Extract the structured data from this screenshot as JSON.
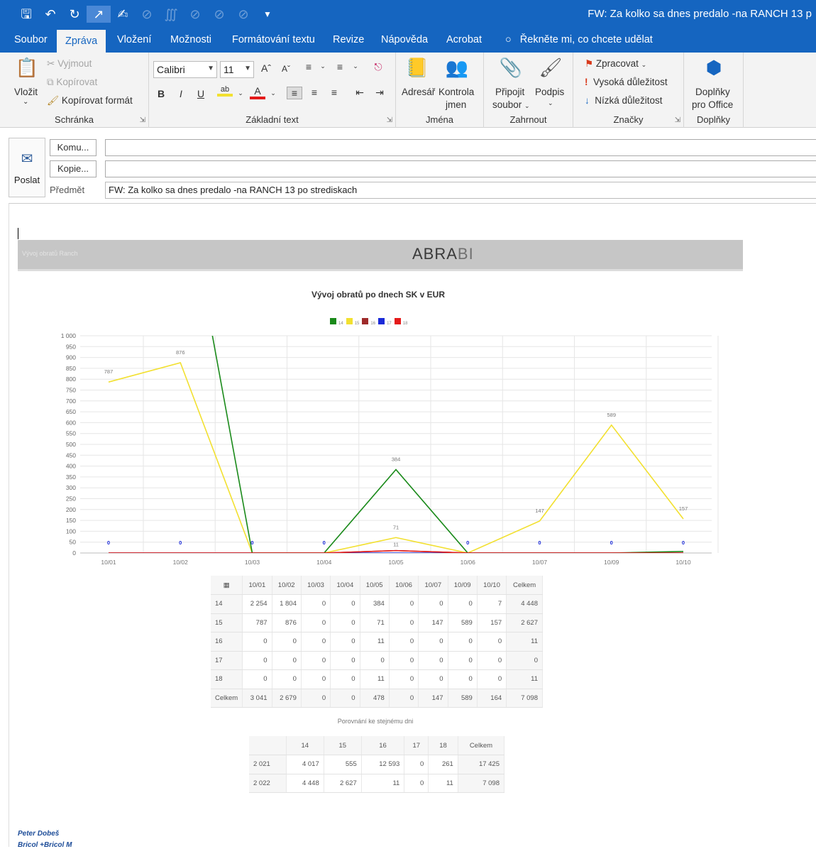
{
  "window": {
    "title": "FW: Za kolko sa dnes predalo -na  RANCH 13  p"
  },
  "quick_access": [
    "save-icon",
    "undo-icon",
    "redo-icon",
    "arrow-icon",
    "touch-icon",
    "brush-icon",
    "formula-icon",
    "brush2-icon",
    "brush3-icon",
    "brush4-icon",
    "customize-icon"
  ],
  "tabs": [
    "Soubor",
    "Zpráva",
    "Vložení",
    "Možnosti",
    "Formátování textu",
    "Revize",
    "Nápověda",
    "Acrobat"
  ],
  "tell_me": "Řekněte mi, co chcete udělat",
  "ribbon": {
    "clipboard": {
      "paste": "Vložit",
      "cut": "Vyjmout",
      "copy": "Kopírovat",
      "format_painter": "Kopírovat formát",
      "label": "Schránka"
    },
    "basic_text": {
      "font": "Calibri",
      "size": "11",
      "label": "Základní text"
    },
    "names": {
      "address_book": "Adresář",
      "check_names_1": "Kontrola",
      "check_names_2": "jmen",
      "label": "Jména"
    },
    "include": {
      "attach_1": "Připojit",
      "attach_2": "soubor",
      "signature": "Podpis",
      "label": "Zahrnout"
    },
    "tags": {
      "followup": "Zpracovat",
      "high": "Vysoká důležitost",
      "low": "Nízká důležitost",
      "label": "Značky"
    },
    "addins": {
      "office_1": "Doplňky",
      "office_2": "pro Office",
      "label": "Doplňky"
    }
  },
  "compose": {
    "send": "Poslat",
    "to": "Komu...",
    "cc": "Kopie...",
    "subject_label": "Předmět",
    "subject": "FW: Za kolko sa dnes predalo -na  RANCH 13  po strediskach"
  },
  "report": {
    "small_title": "Vývoj obratů Ranch",
    "brand_main": "ABRA",
    "brand_sub": "BI"
  },
  "chart_data": {
    "type": "line",
    "title": "Vývoj obratů po dnech SK v EUR",
    "categories": [
      "10/01",
      "10/02",
      "10/03",
      "10/04",
      "10/05",
      "10/06",
      "10/07",
      "10/09",
      "10/10"
    ],
    "ylim": [
      0,
      1000
    ],
    "yticks": [
      "0",
      "50",
      "100",
      "150",
      "200",
      "250",
      "300",
      "350",
      "400",
      "450",
      "500",
      "550",
      "600",
      "650",
      "700",
      "750",
      "800",
      "850",
      "900",
      "950",
      "1 000"
    ],
    "series": [
      {
        "name": "14",
        "color": "#1a8a1a",
        "values": [
          2254,
          1804,
          0,
          0,
          384,
          0,
          0,
          0,
          7
        ]
      },
      {
        "name": "15",
        "color": "#f2e030",
        "values": [
          787,
          876,
          0,
          0,
          71,
          0,
          147,
          589,
          157
        ]
      },
      {
        "name": "16",
        "color": "#9e2a2a",
        "values": [
          0,
          0,
          0,
          0,
          11,
          0,
          0,
          0,
          0
        ]
      },
      {
        "name": "17",
        "color": "#1a2ad8",
        "values": [
          0,
          0,
          0,
          0,
          0,
          0,
          0,
          0,
          0
        ]
      },
      {
        "name": "18",
        "color": "#e41a1a",
        "values": [
          0,
          0,
          0,
          0,
          11,
          0,
          0,
          0,
          0
        ]
      }
    ],
    "point_labels": {
      "14": [
        "",
        "",
        "",
        "",
        "384",
        "",
        "",
        "",
        ""
      ],
      "15": [
        "787",
        "876",
        "",
        "",
        "71",
        "",
        "147",
        "589",
        "157"
      ],
      "16": [
        "",
        "",
        "",
        "",
        "11",
        "",
        "",
        "",
        ""
      ],
      "marker_zero": "0"
    }
  },
  "table1": {
    "corner": "",
    "headers": [
      "10/01",
      "10/02",
      "10/03",
      "10/04",
      "10/05",
      "10/06",
      "10/07",
      "10/09",
      "10/10",
      "Celkem"
    ],
    "rows": [
      {
        "label": "14",
        "cells": [
          "2 254",
          "1 804",
          "0",
          "0",
          "384",
          "0",
          "0",
          "0",
          "7",
          "4 448"
        ]
      },
      {
        "label": "15",
        "cells": [
          "787",
          "876",
          "0",
          "0",
          "71",
          "0",
          "147",
          "589",
          "157",
          "2 627"
        ]
      },
      {
        "label": "16",
        "cells": [
          "0",
          "0",
          "0",
          "0",
          "11",
          "0",
          "0",
          "0",
          "0",
          "11"
        ]
      },
      {
        "label": "17",
        "cells": [
          "0",
          "0",
          "0",
          "0",
          "0",
          "0",
          "0",
          "0",
          "0",
          "0"
        ]
      },
      {
        "label": "18",
        "cells": [
          "0",
          "0",
          "0",
          "0",
          "11",
          "0",
          "0",
          "0",
          "0",
          "11"
        ]
      },
      {
        "label": "Celkem",
        "cells": [
          "3 041",
          "2 679",
          "0",
          "0",
          "478",
          "0",
          "147",
          "589",
          "164",
          "7 098"
        ]
      }
    ]
  },
  "table2": {
    "caption": "Porovnání ke stejnému dni",
    "headers": [
      "",
      "14",
      "15",
      "16",
      "17",
      "18",
      "Celkem"
    ],
    "rows": [
      [
        "2 021",
        "4 017",
        "555",
        "12 593",
        "0",
        "261",
        "17 425"
      ],
      [
        "2 022",
        "4 448",
        "2 627",
        "11",
        "0",
        "11",
        "7 098"
      ]
    ]
  },
  "signature": {
    "name": "Peter Dobeš",
    "company": "Bricol +Bricol M"
  }
}
